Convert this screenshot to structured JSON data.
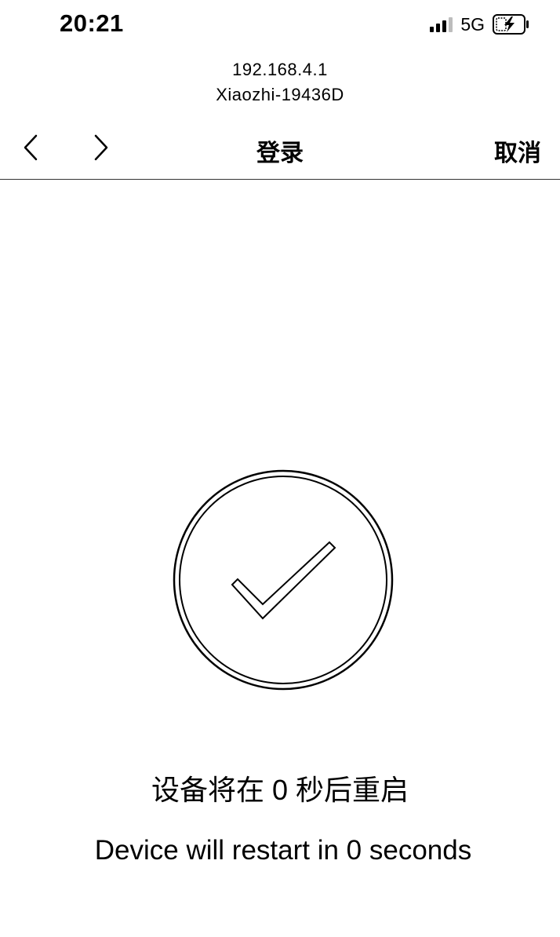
{
  "status_bar": {
    "time": "20:21",
    "network": "5G",
    "signal_icon": "cellular-signal-icon",
    "battery_icon": "battery-charging-icon"
  },
  "address": {
    "host": "192.168.4.1",
    "ssid": "Xiaozhi-19436D"
  },
  "nav": {
    "back_icon": "chevron-left-icon",
    "forward_icon": "chevron-right-icon",
    "title": "登录",
    "cancel_label": "取消"
  },
  "content": {
    "status_icon": "check-circle-icon",
    "message_cn": "设备将在 0 秒后重启",
    "message_en": "Device will restart in 0 seconds"
  }
}
